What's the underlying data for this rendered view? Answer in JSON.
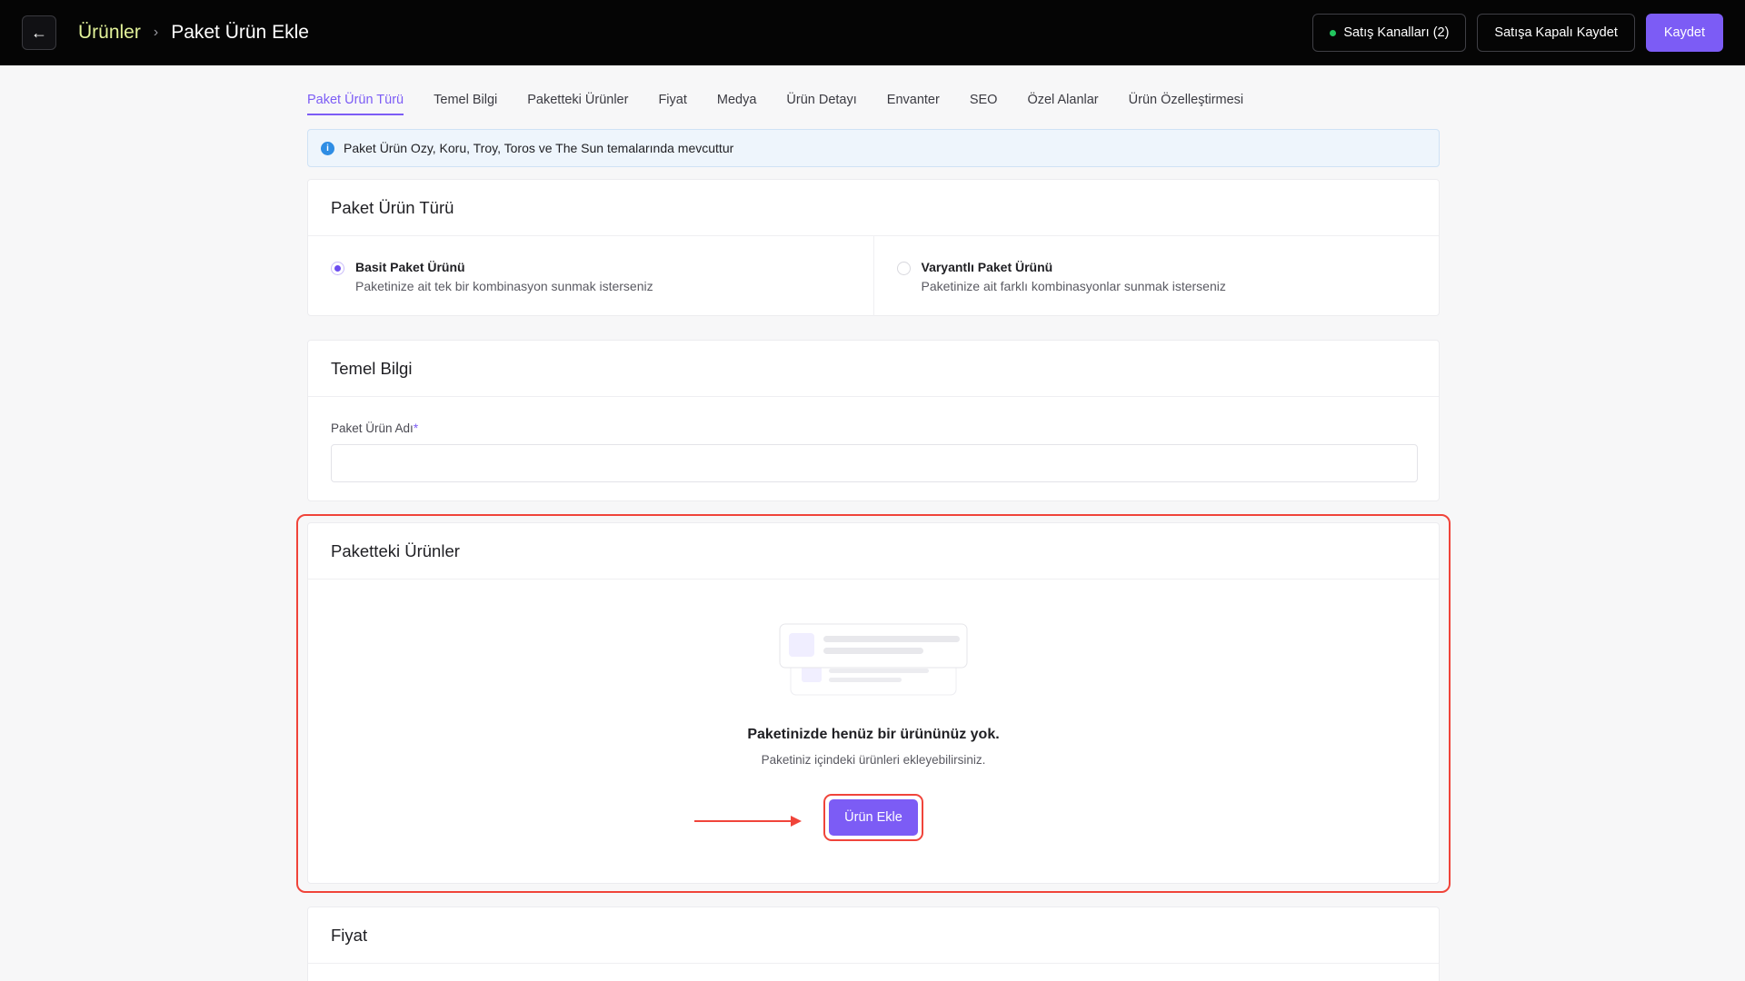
{
  "header": {
    "back_icon": "arrow-left-icon",
    "breadcrumb_parent": "Ürünler",
    "breadcrumb_separator": "›",
    "breadcrumb_current": "Paket Ürün Ekle",
    "sales_channels_label": "Satış Kanalları (2)",
    "save_closed_label": "Satışa Kapalı Kaydet",
    "save_label": "Kaydet"
  },
  "tabs": [
    {
      "label": "Paket Ürün Türü",
      "active": true
    },
    {
      "label": "Temel Bilgi"
    },
    {
      "label": "Paketteki Ürünler"
    },
    {
      "label": "Fiyat"
    },
    {
      "label": "Medya"
    },
    {
      "label": "Ürün Detayı"
    },
    {
      "label": "Envanter"
    },
    {
      "label": "SEO"
    },
    {
      "label": "Özel Alanlar"
    },
    {
      "label": "Ürün Özelleştirmesi"
    }
  ],
  "info_banner": {
    "icon": "info-icon",
    "text": "Paket Ürün Ozy, Koru, Troy, Toros ve The Sun temalarında mevcuttur"
  },
  "type_section": {
    "title": "Paket Ürün Türü",
    "options": [
      {
        "title": "Basit Paket Ürünü",
        "description": "Paketinize ait tek bir kombinasyon sunmak isterseniz",
        "selected": true
      },
      {
        "title": "Varyantlı Paket Ürünü",
        "description": "Paketinize ait farklı kombinasyonlar sunmak isterseniz",
        "selected": false
      }
    ]
  },
  "basic_info": {
    "title": "Temel Bilgi",
    "name_label": "Paket Ürün Adı",
    "required_mark": "*",
    "name_value": ""
  },
  "package_products": {
    "title": "Paketteki Ürünler",
    "empty_title": "Paketinizde henüz bir ürününüz yok.",
    "empty_description": "Paketiniz içindeki ürünleri ekleyebilirsiniz.",
    "add_button_label": "Ürün Ekle"
  },
  "price_section": {
    "title": "Fiyat"
  },
  "colors": {
    "accent": "#7c5cf5",
    "topbar": "#050505",
    "breadcrumb_parent": "#e3f39a",
    "annotation": "#f0443a",
    "status_dot": "#22c55e"
  }
}
